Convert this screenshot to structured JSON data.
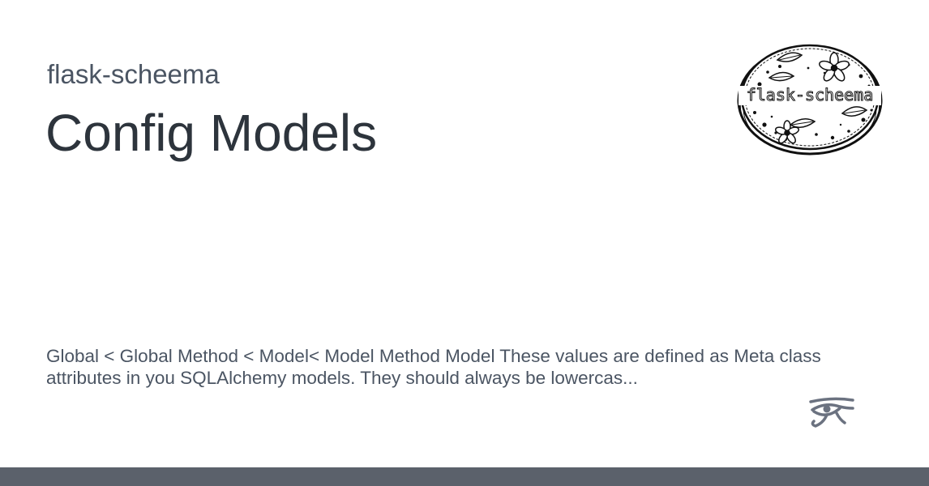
{
  "header": {
    "site_name": "flask-scheema",
    "page_title": "Config Models"
  },
  "logo": {
    "text": "flask-scheema",
    "icon": "flower-plate-logo"
  },
  "main": {
    "description": "Global < Global Method < Model< Model Method Model These values are defined as Meta class attributes in you SQLAlchemy models. They should always be lowercas..."
  },
  "badge": {
    "icon": "eye-of-horus-icon"
  },
  "colors": {
    "background": "#ffffff",
    "site_name": "#4b5563",
    "title": "#2d343c",
    "description": "#4b5563",
    "footer_bar": "#5b616b",
    "eye_icon": "#6b7280"
  }
}
